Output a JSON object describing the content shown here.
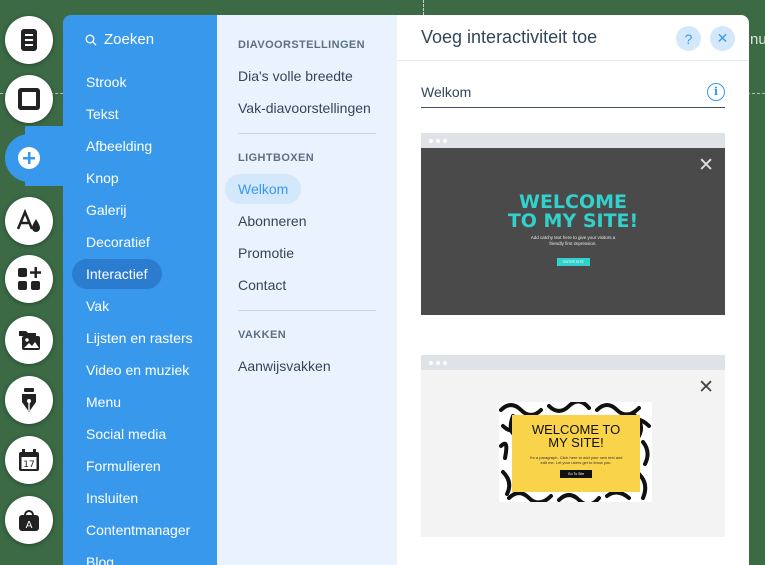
{
  "background": {
    "edge_text": "nu"
  },
  "search": {
    "label": "Zoeken"
  },
  "categories": [
    "Strook",
    "Tekst",
    "Afbeelding",
    "Knop",
    "Galerij",
    "Decoratief",
    "Interactief",
    "Vak",
    "Lijsten en rasters",
    "Video en muziek",
    "Menu",
    "Social media",
    "Formulieren",
    "Insluiten",
    "Contentmanager",
    "Blog"
  ],
  "active_category": "Interactief",
  "subpanel": {
    "slideshows": {
      "heading": "DIAVOORSTELLINGEN",
      "items": [
        "Dia's volle breedte",
        "Vak-diavoorstellingen"
      ]
    },
    "lightboxes": {
      "heading": "LIGHTBOXEN",
      "items": [
        "Welkom",
        "Abonneren",
        "Promotie",
        "Contact"
      ]
    },
    "boxes": {
      "heading": "VAKKEN",
      "items": [
        "Aanwijsvakken"
      ]
    },
    "active_item": "Welkom"
  },
  "content": {
    "title": "Voeg interactiviteit toe",
    "help": "?",
    "close": "✕",
    "section": "Welkom",
    "info": "i",
    "thumb1": {
      "headline_1": "WELCOME",
      "headline_2": "TO MY SITE!",
      "sub_1": "Add catchy text here to give your visitors a",
      "sub_2": "friendly first impression.",
      "cta": "ENTER SITE"
    },
    "thumb2": {
      "headline_1": "WELCOME TO",
      "headline_2": "MY SITE!",
      "sub_1": "I'm a paragraph. Click here to add your own text and",
      "sub_2": "edit me. Let your users get to know you.",
      "cta": "Go To Site"
    }
  },
  "colors": {
    "accent": "#3899ec",
    "category_panel": "#3899ec",
    "active_category": "#2b7ccf",
    "subpanel": "#eaf3fd",
    "teal": "#33d1cc",
    "yellow": "#f9d34a",
    "canvas": "#3b6a45"
  },
  "icons": [
    "pages-icon",
    "section-icon",
    "add-icon",
    "design-icon",
    "add-apps-icon",
    "media-icon",
    "pen-icon",
    "calendar-icon",
    "store-icon"
  ]
}
